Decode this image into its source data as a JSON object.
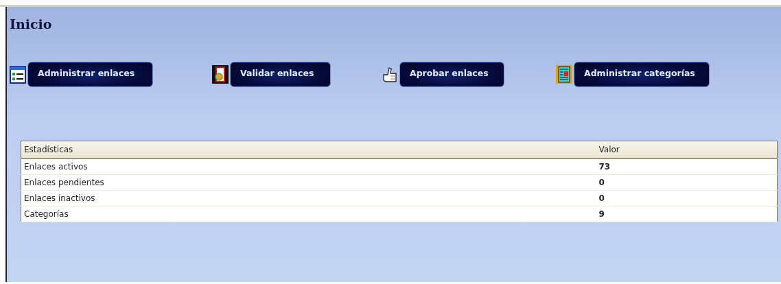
{
  "page": {
    "title": "Inicio"
  },
  "actions": [
    {
      "label": "Administrar enlaces",
      "kind": "list"
    },
    {
      "label": "Validar enlaces",
      "kind": "document"
    },
    {
      "label": "Aprobar enlaces",
      "kind": "thumb"
    },
    {
      "label": "Administrar categorías",
      "kind": "newspaper"
    }
  ],
  "table": {
    "columns": [
      "Estadísticas",
      "Valor"
    ],
    "rows": [
      [
        "Enlaces activos",
        "73"
      ],
      [
        "Enlaces pendientes",
        "0"
      ],
      [
        "Enlaces inactivos",
        "0"
      ],
      [
        "Categorías",
        "9"
      ]
    ]
  }
}
